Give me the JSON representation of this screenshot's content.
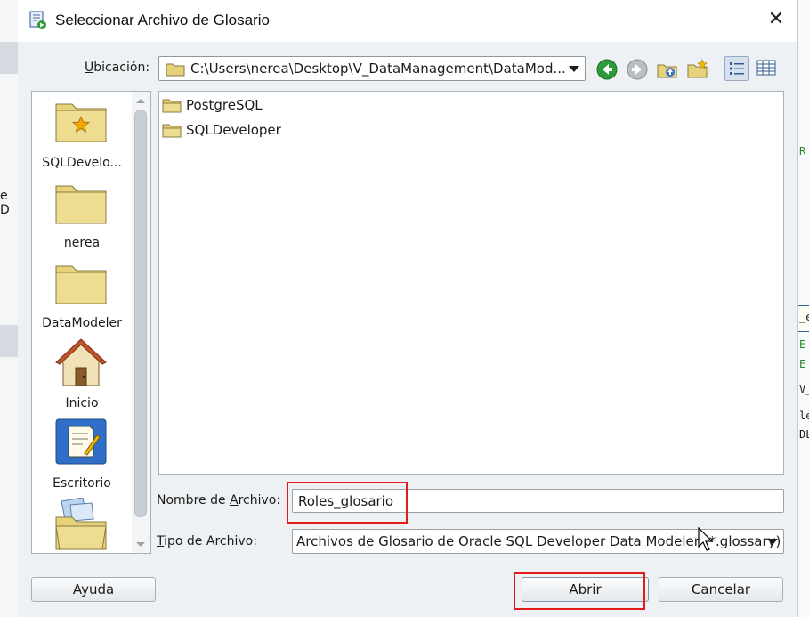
{
  "background": {
    "left_fragment": "e D",
    "right_fragments": [
      "R",
      "_e",
      "E",
      "E",
      "V_",
      "le",
      "DL"
    ]
  },
  "dialog": {
    "title": "Seleccionar Archivo de Glosario",
    "close_symbol": "✕"
  },
  "location": {
    "label_pre": "",
    "label_mn": "U",
    "label_post": "bicación:",
    "path": "C:\\Users\\nerea\\Desktop\\V_DataManagement\\DataMod..."
  },
  "toolbar": {
    "back_icon": "back-arrow-icon",
    "forward_icon": "forward-arrow-icon",
    "up_icon": "up-one-level-icon",
    "new_folder_icon": "new-folder-icon",
    "list_view_icon": "list-view-icon",
    "details_view_icon": "details-view-icon"
  },
  "places": [
    {
      "label": "SQLDevelo...",
      "icon": "favorite-folder-icon"
    },
    {
      "label": "nerea",
      "icon": "folder-icon"
    },
    {
      "label": "DataModeler",
      "icon": "folder-icon"
    },
    {
      "label": "Inicio",
      "icon": "home-icon"
    },
    {
      "label": "Escritorio",
      "icon": "desktop-icon"
    },
    {
      "label": "",
      "icon": "documents-folder-icon"
    }
  ],
  "files": [
    {
      "name": "PostgreSQL",
      "icon": "folder-icon"
    },
    {
      "name": "SQLDeveloper",
      "icon": "folder-icon"
    }
  ],
  "filename": {
    "label_pre": "Nombre de ",
    "label_mn": "A",
    "label_post": "rchivo:",
    "value": "Roles_glosario"
  },
  "filetype": {
    "label_pre": "",
    "label_mn": "T",
    "label_post": "ipo de Archivo:",
    "value": "Archivos de Glosario de Oracle SQL Developer Data Modeler (*.glossary)"
  },
  "buttons": {
    "help": "Ayuda",
    "open": "Abrir",
    "cancel": "Cancelar"
  },
  "colors": {
    "annotation_red": "#e31b1b",
    "folder_yellow": "#e7d27c",
    "nav_green": "#2e9b3a"
  }
}
